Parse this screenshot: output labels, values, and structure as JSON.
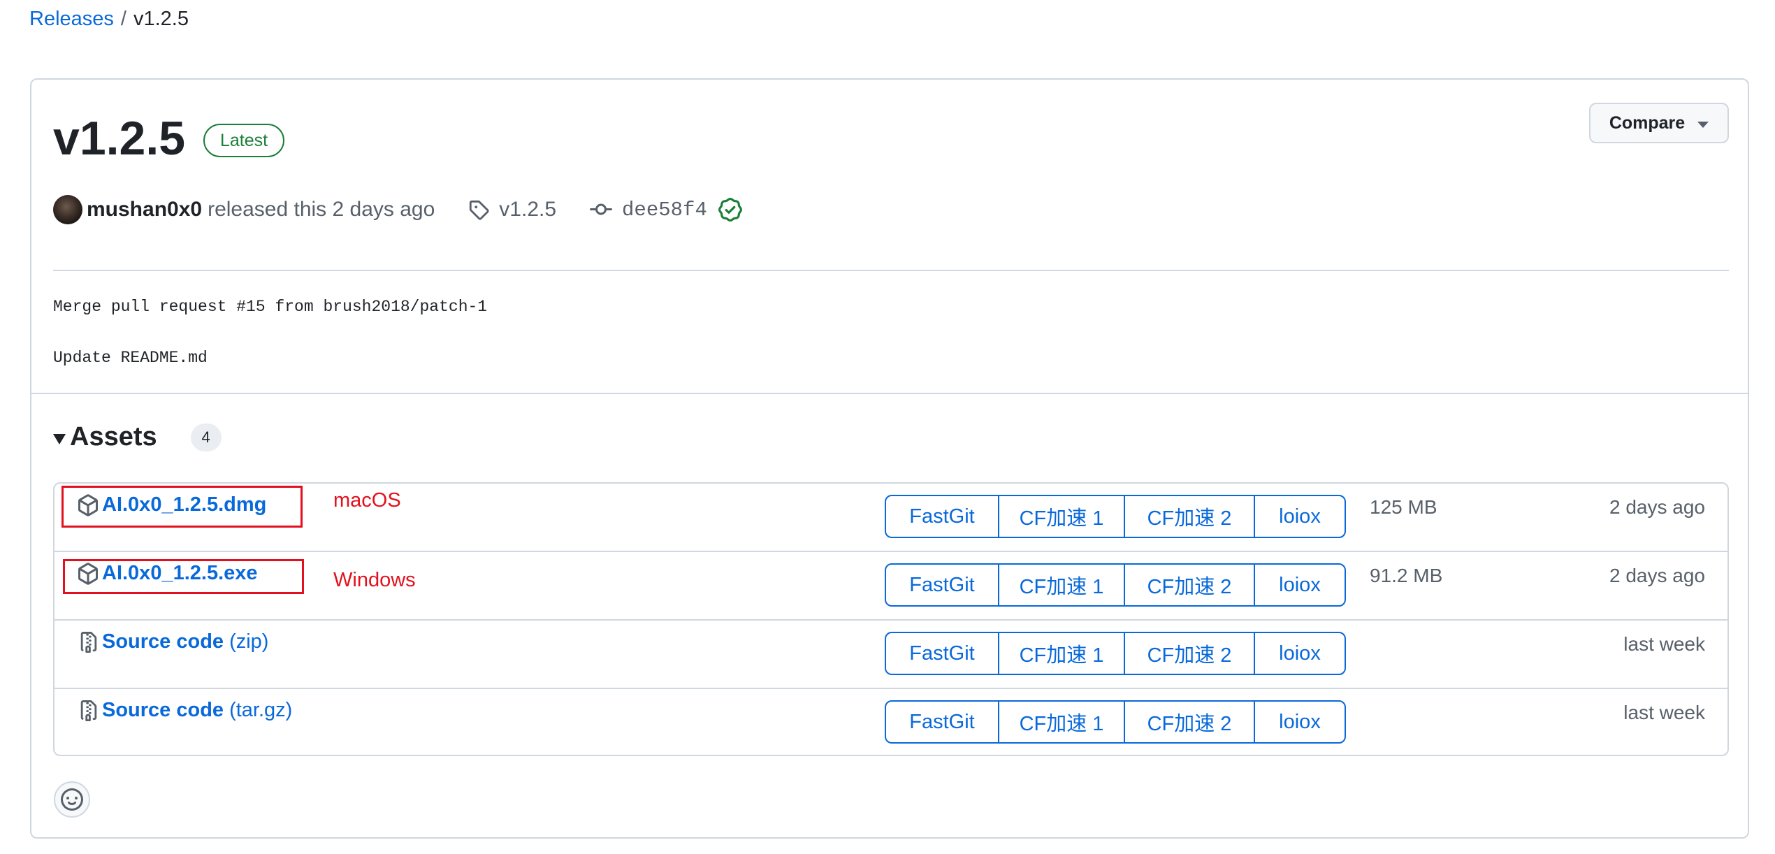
{
  "breadcrumb": {
    "parent": "Releases",
    "separator": "/",
    "current": "v1.2.5"
  },
  "release": {
    "title": "v1.2.5",
    "badge": "Latest",
    "compare_label": "Compare",
    "author": "mushan0x0",
    "released_text": "released this 2 days ago",
    "tag": "v1.2.5",
    "commit": "dee58f4",
    "message_lines": [
      "Merge pull request #15 from brush2018/patch-1",
      "Update README.md"
    ]
  },
  "assets": {
    "title": "Assets",
    "count": "4",
    "mirror_labels": [
      "FastGit",
      "CF加速 1",
      "CF加速 2",
      "loiox"
    ],
    "rows": [
      {
        "name": "AI.0x0_1.2.5.dmg",
        "suffix": "",
        "annotation": "macOS",
        "size": "125 MB",
        "date": "2 days ago",
        "icon": "package-icon"
      },
      {
        "name": "AI.0x0_1.2.5.exe",
        "suffix": "",
        "annotation": "Windows",
        "size": "91.2 MB",
        "date": "2 days ago",
        "icon": "package-icon"
      },
      {
        "name": "Source code",
        "suffix": "(zip)",
        "annotation": "",
        "size": "",
        "date": "last week",
        "icon": "file-zip-icon"
      },
      {
        "name": "Source code",
        "suffix": "(tar.gz)",
        "annotation": "",
        "size": "",
        "date": "last week",
        "icon": "file-zip-icon"
      }
    ]
  },
  "colors": {
    "link": "#0969da",
    "success": "#1a7f37",
    "annotation": "#e3111d",
    "border": "#d0d7de"
  }
}
